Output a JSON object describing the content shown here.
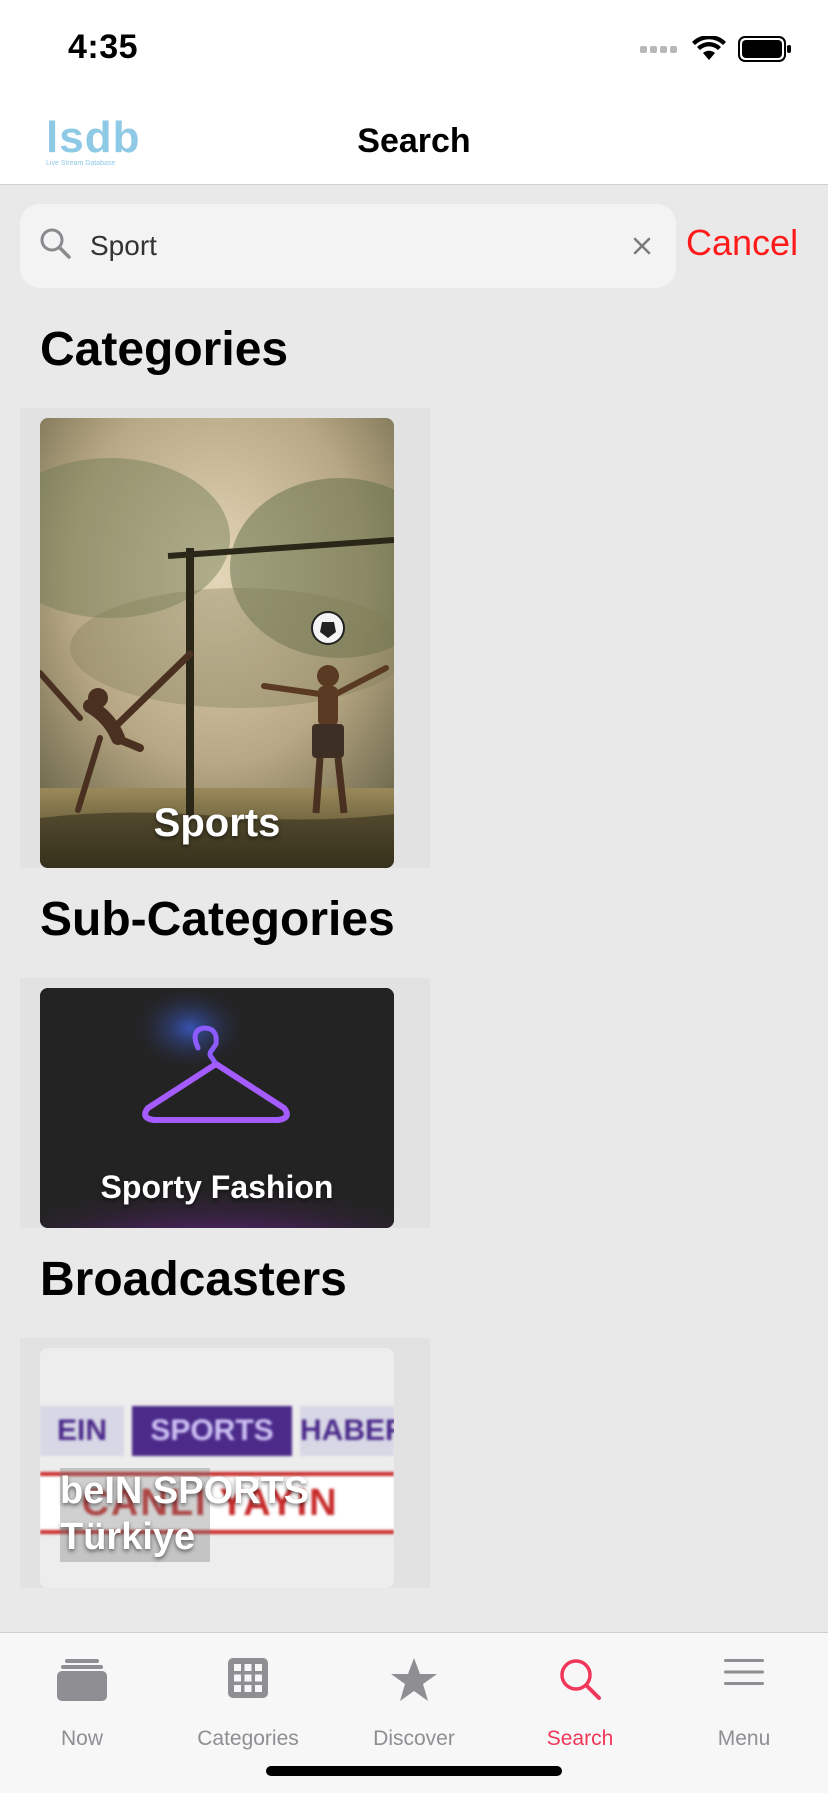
{
  "status": {
    "time": "4:35"
  },
  "nav": {
    "logo_main": "lsdb",
    "logo_sub": "Live Stream Database",
    "title": "Search"
  },
  "search": {
    "value": "Sport",
    "cancel_label": "Cancel"
  },
  "sections": {
    "categories": {
      "title": "Categories",
      "card_label": "Sports"
    },
    "subcategories": {
      "title": "Sub-Categories",
      "card_label": "Sporty Fashion"
    },
    "broadcasters": {
      "title": "Broadcasters",
      "card_label_line1": "beIN SPORTS",
      "card_label_line2": "Türkiye",
      "banner_line1": "SPORTS",
      "banner_line1_left": "EIN",
      "banner_line1_right": "HABER",
      "banner_line2": "CANLI YAYIN"
    }
  },
  "tabs": [
    {
      "label": "Now",
      "icon": "stack-icon"
    },
    {
      "label": "Categories",
      "icon": "grid-icon"
    },
    {
      "label": "Discover",
      "icon": "star-icon"
    },
    {
      "label": "Search",
      "icon": "search-icon",
      "active": true
    },
    {
      "label": "Menu",
      "icon": "hamburger-icon"
    }
  ],
  "colors": {
    "accent_red": "#ff1a1a",
    "tab_active": "#f0375a",
    "logo": "#8ecae6"
  }
}
